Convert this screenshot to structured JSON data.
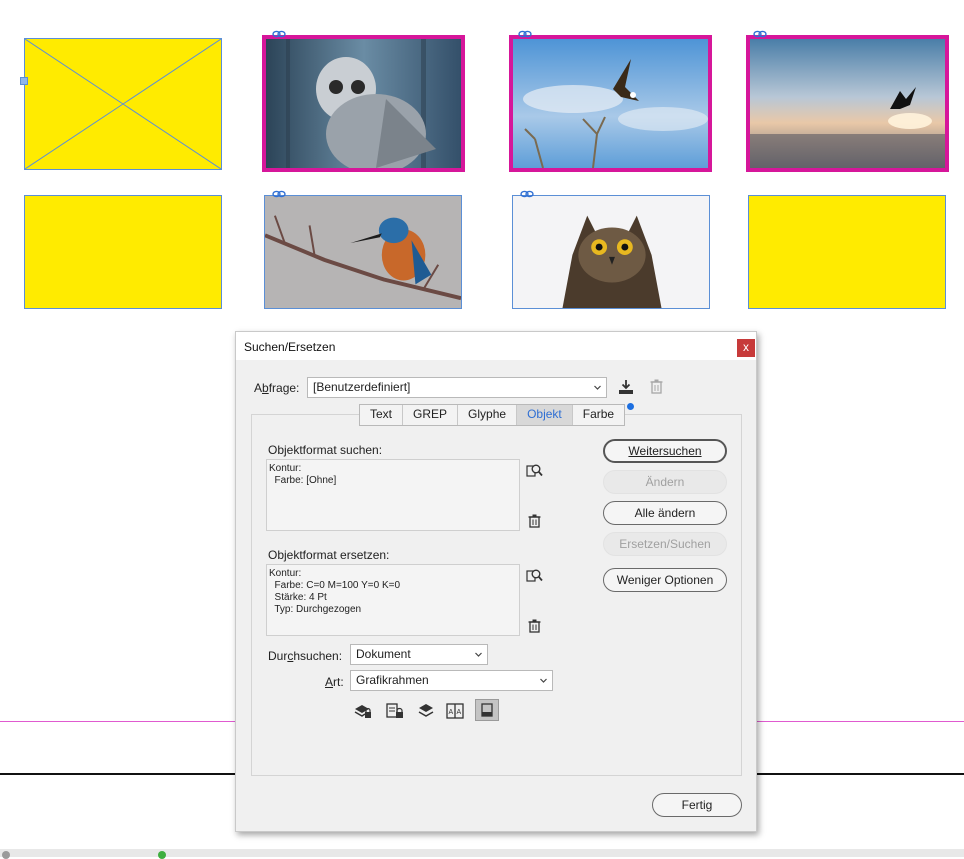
{
  "dialog": {
    "title": "Suchen/Ersetzen",
    "close_label": "x",
    "query": {
      "label": "Abfrage:",
      "value": "[Benutzerdefiniert]"
    },
    "tabs": [
      {
        "label": "Text"
      },
      {
        "label": "GREP"
      },
      {
        "label": "Glyphe"
      },
      {
        "label": "Objekt",
        "active": true
      },
      {
        "label": "Farbe"
      }
    ],
    "find_section": {
      "label": "Objektformat suchen:",
      "text": "Kontur:\n  Farbe: [Ohne]"
    },
    "replace_section": {
      "label": "Objektformat ersetzen:",
      "text": "Kontur:\n  Farbe: C=0 M=100 Y=0 K=0\n  Stärke: 4 Pt\n  Typ: Durchgezogen"
    },
    "search_in": {
      "label": "Durchsuchen:",
      "value": "Dokument"
    },
    "type": {
      "label": "Art:",
      "value": "Grafikrahmen"
    },
    "buttons": {
      "find_next": "Weitersuchen",
      "change": "Ändern",
      "change_all": "Alle ändern",
      "change_find": "Ersetzen/Suchen",
      "fewer_options": "Weniger Optionen",
      "done": "Fertig"
    }
  },
  "colors": {
    "frame_fill": "#ffeb00",
    "highlight_stroke": "#d6169a",
    "frame_edge": "#5b8fd6",
    "active_tab": "#2f6fd3"
  }
}
